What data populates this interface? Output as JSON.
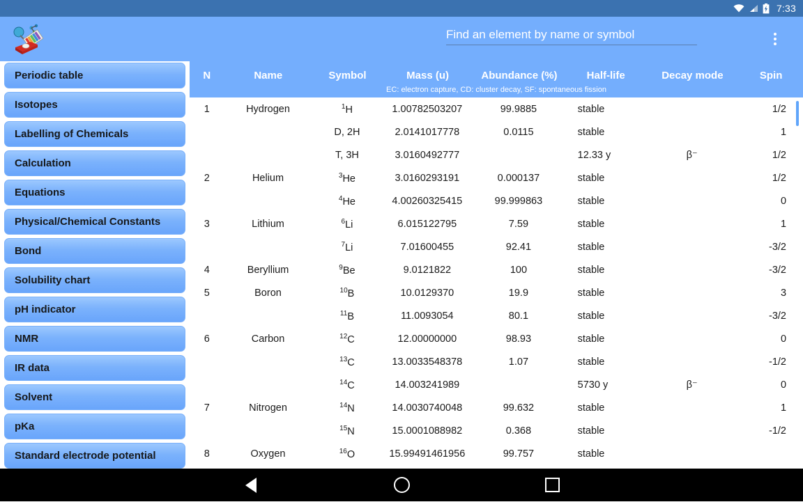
{
  "status_bar": {
    "time": "7:33",
    "icons": [
      "wifi-icon",
      "cell-signal-icon",
      "battery-charging-icon"
    ]
  },
  "appbar": {
    "logo_name": "chemistry-app-logo",
    "search_placeholder": "Find an element by name or symbol",
    "search_value": "",
    "overflow_label": "More options"
  },
  "sidebar": {
    "items": [
      {
        "label": "Periodic table"
      },
      {
        "label": "Isotopes"
      },
      {
        "label": "Labelling of Chemicals"
      },
      {
        "label": "Calculation"
      },
      {
        "label": "Equations"
      },
      {
        "label": "Physical/Chemical Constants"
      },
      {
        "label": "Bond"
      },
      {
        "label": "Solubility chart"
      },
      {
        "label": "pH indicator"
      },
      {
        "label": "NMR"
      },
      {
        "label": "IR data"
      },
      {
        "label": "Solvent"
      },
      {
        "label": "pKa"
      },
      {
        "label": "Standard electrode potential"
      }
    ]
  },
  "table": {
    "columns": [
      "N",
      "Name",
      "Symbol",
      "Mass (u)",
      "Abundance (%)",
      "Half-life",
      "Decay mode",
      "Spin"
    ],
    "note": "EC: electron capture, CD: cluster decay, SF: spontaneous fission",
    "rows": [
      {
        "n": "1",
        "name": "Hydrogen",
        "sym_sup": "1",
        "sym_base": "H",
        "mass": "1.00782503207",
        "abundance": "99.9885",
        "half_life": "stable",
        "decay": "",
        "spin": "1/2"
      },
      {
        "n": "",
        "name": "",
        "sym_sup": "",
        "sym_base": "D, 2H",
        "mass": "2.0141017778",
        "abundance": "0.0115",
        "half_life": "stable",
        "decay": "",
        "spin": "1"
      },
      {
        "n": "",
        "name": "",
        "sym_sup": "",
        "sym_base": "T, 3H",
        "mass": "3.0160492777",
        "abundance": "",
        "half_life": "12.33 y",
        "decay": "β⁻",
        "spin": "1/2"
      },
      {
        "n": "2",
        "name": "Helium",
        "sym_sup": "3",
        "sym_base": "He",
        "mass": "3.0160293191",
        "abundance": "0.000137",
        "half_life": "stable",
        "decay": "",
        "spin": "1/2"
      },
      {
        "n": "",
        "name": "",
        "sym_sup": "4",
        "sym_base": "He",
        "mass": "4.00260325415",
        "abundance": "99.999863",
        "half_life": "stable",
        "decay": "",
        "spin": "0"
      },
      {
        "n": "3",
        "name": "Lithium",
        "sym_sup": "6",
        "sym_base": "Li",
        "mass": "6.015122795",
        "abundance": "7.59",
        "half_life": "stable",
        "decay": "",
        "spin": "1"
      },
      {
        "n": "",
        "name": "",
        "sym_sup": "7",
        "sym_base": "Li",
        "mass": "7.01600455",
        "abundance": "92.41",
        "half_life": "stable",
        "decay": "",
        "spin": "-3/2"
      },
      {
        "n": "4",
        "name": "Beryllium",
        "sym_sup": "9",
        "sym_base": "Be",
        "mass": "9.0121822",
        "abundance": "100",
        "half_life": "stable",
        "decay": "",
        "spin": "-3/2"
      },
      {
        "n": "5",
        "name": "Boron",
        "sym_sup": "10",
        "sym_base": "B",
        "mass": "10.0129370",
        "abundance": "19.9",
        "half_life": "stable",
        "decay": "",
        "spin": "3"
      },
      {
        "n": "",
        "name": "",
        "sym_sup": "11",
        "sym_base": "B",
        "mass": "11.0093054",
        "abundance": "80.1",
        "half_life": "stable",
        "decay": "",
        "spin": "-3/2"
      },
      {
        "n": "6",
        "name": "Carbon",
        "sym_sup": "12",
        "sym_base": "C",
        "mass": "12.00000000",
        "abundance": "98.93",
        "half_life": "stable",
        "decay": "",
        "spin": "0"
      },
      {
        "n": "",
        "name": "",
        "sym_sup": "13",
        "sym_base": "C",
        "mass": "13.0033548378",
        "abundance": "1.07",
        "half_life": "stable",
        "decay": "",
        "spin": "-1/2"
      },
      {
        "n": "",
        "name": "",
        "sym_sup": "14",
        "sym_base": "C",
        "mass": "14.003241989",
        "abundance": "",
        "half_life": "5730 y",
        "decay": "β⁻",
        "spin": "0"
      },
      {
        "n": "7",
        "name": "Nitrogen",
        "sym_sup": "14",
        "sym_base": "N",
        "mass": "14.0030740048",
        "abundance": "99.632",
        "half_life": "stable",
        "decay": "",
        "spin": "1"
      },
      {
        "n": "",
        "name": "",
        "sym_sup": "15",
        "sym_base": "N",
        "mass": "15.0001088982",
        "abundance": "0.368",
        "half_life": "stable",
        "decay": "",
        "spin": "-1/2"
      },
      {
        "n": "8",
        "name": "Oxygen",
        "sym_sup": "16",
        "sym_base": "O",
        "mass": "15.99491461956",
        "abundance": "99.757",
        "half_life": "stable",
        "decay": "",
        "spin": ""
      }
    ]
  },
  "navbar": {
    "back_label": "Back",
    "home_label": "Home",
    "recents_label": "Recent apps"
  },
  "colors": {
    "status_bar": "#3b72b0",
    "accent": "#74aefd",
    "sidebar_button": "#7bb2fc",
    "scrollbar": "#60a5fa"
  }
}
